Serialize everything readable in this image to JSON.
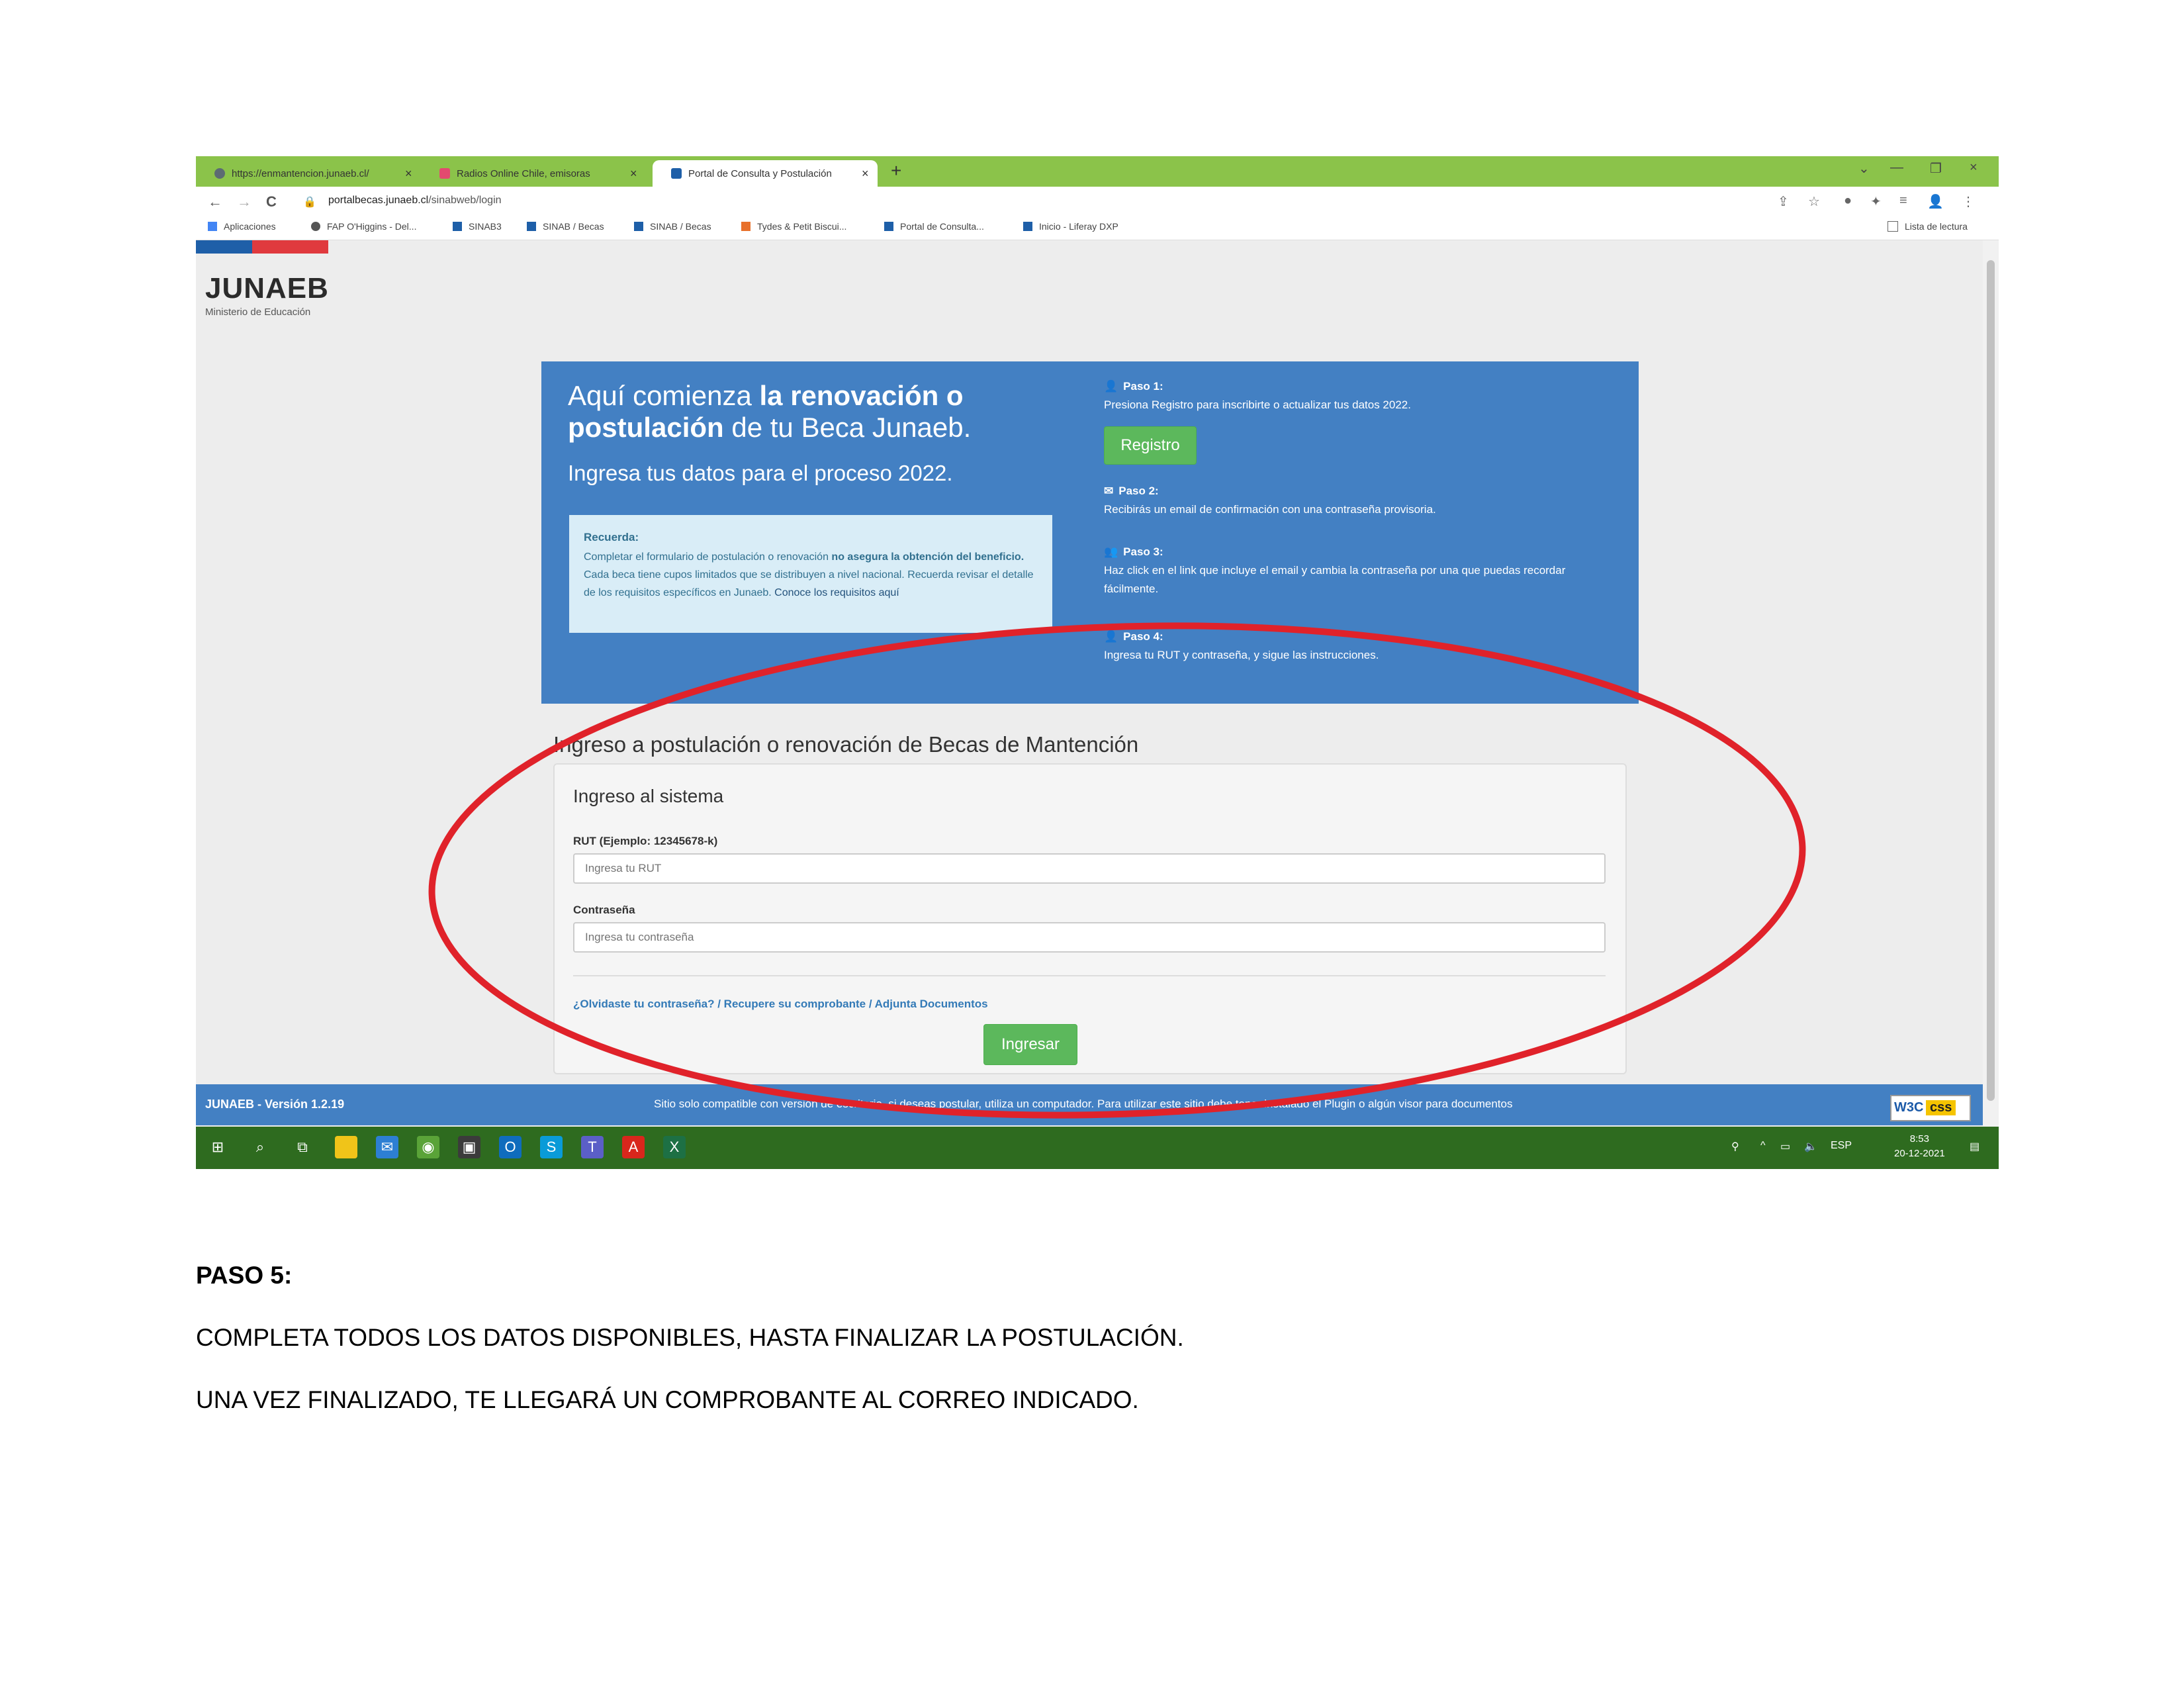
{
  "browser": {
    "tabs": [
      {
        "title": "https://enmantencion.junaeb.cl/",
        "favicon_color": "#5c6b73"
      },
      {
        "title": "Radios Online Chile, emisoras",
        "favicon_color": "#e34a6f"
      },
      {
        "title": "Portal de Consulta y Postulación",
        "favicon_color": "#1e5fa8"
      }
    ],
    "new_tab": "+",
    "close": "×",
    "nav": {
      "back": "←",
      "forward": "→",
      "reload": "C"
    },
    "url_domain": "portalbecas.junaeb.cl",
    "url_path": "/sinabweb/login",
    "bookmarks": [
      {
        "label": "Aplicaciones",
        "color": "#4285f4"
      },
      {
        "label": "FAP O'Higgins - Del...",
        "color": "#555555"
      },
      {
        "label": "SINAB3",
        "color": "#1e5fa8"
      },
      {
        "label": "SINAB / Becas",
        "color": "#1e5fa8"
      },
      {
        "label": "SINAB / Becas",
        "color": "#1e5fa8"
      },
      {
        "label": "Tydes & Petit Biscui...",
        "color": "#e8712c"
      },
      {
        "label": "Portal de Consulta...",
        "color": "#1e5fa8"
      },
      {
        "label": "Inicio - Liferay DXP",
        "color": "#1e5fa8"
      }
    ],
    "reading_list": "Lista de lectura"
  },
  "page": {
    "logo": "JUNAEB",
    "logo_sub": "Ministerio de Educación",
    "hero": {
      "heading_pre": "Aquí comienza ",
      "heading_bold1": "la renovación o postulación",
      "heading_post": " de tu Beca Junaeb.",
      "subheading": "Ingresa tus datos para el proceso 2022.",
      "note_title": "Recuerda:",
      "note_pre": "Completar el formulario de postulación o renovación ",
      "note_bold": "no asegura la obtención del beneficio.",
      "note_post": " Cada beca tiene cupos limitados que se distribuyen a nivel nacional. Recuerda revisar el detalle de los requisitos específicos en Junaeb. ",
      "note_link": "Conoce los requisitos aquí"
    },
    "steps": [
      {
        "title": "Paso 1:",
        "body": "Presiona Registro para inscribirte o actualizar tus datos 2022."
      },
      {
        "title": "Paso 2:",
        "body": "Recibirás un email de confirmación con una contraseña provisoria."
      },
      {
        "title": "Paso 3:",
        "body": "Haz click en el link que incluye el email y cambia la contraseña por una que puedas recordar fácilmente."
      },
      {
        "title": "Paso 4:",
        "body": "Ingresa tu RUT y contraseña, y sigue las instrucciones."
      }
    ],
    "register_button": "Registro",
    "section_title": "Ingreso a postulación o renovación de Becas de Mantención",
    "panel_title": "Ingreso al sistema",
    "rut_label": "RUT (Ejemplo: 12345678-k)",
    "rut_placeholder": "Ingresa tu RUT",
    "password_label": "Contraseña",
    "password_placeholder": "Ingresa tu contraseña",
    "links": "¿Olvidaste tu contraseña? / Recupere su comprobante / Adjunta Documentos",
    "login_button": "Ingresar",
    "footer_version": "JUNAEB - Versión 1.2.19",
    "footer_text": "Sitio solo compatible con versión de escritorio, si deseas postular, utiliza un computador. Para utilizar este sitio debe tener instalado el Plugin o algún visor para documentos portables.",
    "w3c_left": "W3C",
    "w3c_right": "css"
  },
  "taskbar": {
    "time": "8:53",
    "date": "20-12-2021",
    "lang": "ESP"
  },
  "colors": {
    "annotation_ellipse": "#e0222a",
    "hero_blue": "#4380c3",
    "button_green": "#5cb85c",
    "tab_bar_green": "#8bc34a",
    "taskbar_green": "#2e6b1f"
  },
  "document": {
    "heading": "PASO 5:",
    "line1": "COMPLETA TODOS LOS DATOS DISPONIBLES, HASTA FINALIZAR LA POSTULACIÓN.",
    "line2": "UNA VEZ FINALIZADO, TE LLEGARÁ UN COMPROBANTE AL CORREO INDICADO."
  }
}
